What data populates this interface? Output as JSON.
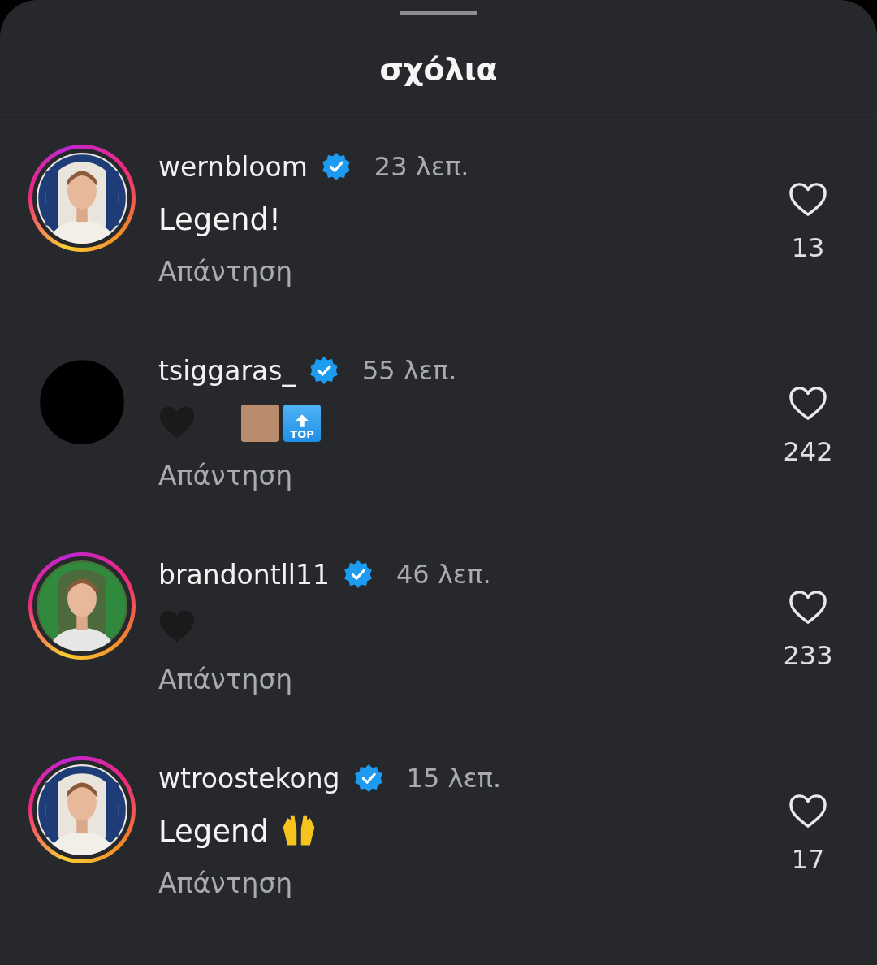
{
  "sheet": {
    "title": "σχόλια"
  },
  "comments": [
    {
      "user": "wernbloom",
      "verified": true,
      "time": "23 λεπ.",
      "story": true,
      "avatar": {
        "kind": "picture"
      },
      "body": [
        {
          "kind": "text",
          "text": "Legend!"
        }
      ],
      "reply": "Απάντηση",
      "likes": "13"
    },
    {
      "user": "tsiggaras_",
      "verified": true,
      "time": "55 λεπ.",
      "story": false,
      "avatar": {
        "kind": "dark"
      },
      "body": [
        {
          "kind": "black-heart"
        },
        {
          "kind": "gap"
        },
        {
          "kind": "brown-square"
        },
        {
          "kind": "top-key",
          "label": "TOP"
        }
      ],
      "reply": "Απάντηση",
      "likes": "242"
    },
    {
      "user": "brandontll11",
      "verified": true,
      "time": "46 λεπ.",
      "story": true,
      "avatar": {
        "kind": "picture"
      },
      "body": [
        {
          "kind": "black-heart"
        }
      ],
      "reply": "Απάντηση",
      "likes": "233"
    },
    {
      "user": "wtroostekong",
      "verified": true,
      "time": "15 λεπ.",
      "story": true,
      "avatar": {
        "kind": "picture"
      },
      "body": [
        {
          "kind": "text",
          "text": "Legend"
        },
        {
          "kind": "raised-hands"
        }
      ],
      "reply": "Απάντηση",
      "likes": "17"
    }
  ]
}
